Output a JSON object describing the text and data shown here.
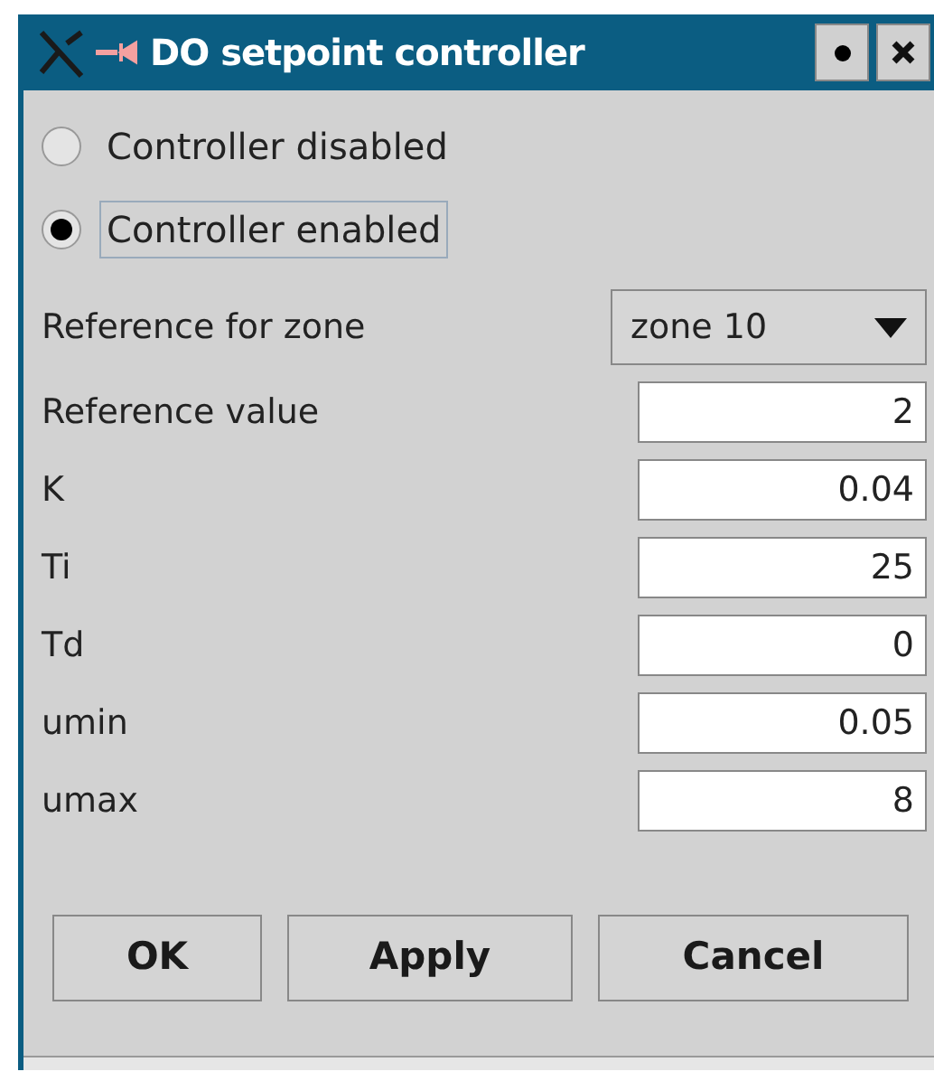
{
  "window": {
    "title": "DO setpoint controller"
  },
  "mode_options": [
    {
      "label": "Controller disabled",
      "selected": false
    },
    {
      "label": "Controller enabled",
      "selected": true
    }
  ],
  "zone": {
    "label": "Reference for zone",
    "value": "zone 10"
  },
  "parameters": [
    {
      "label": "Reference value",
      "value": "2"
    },
    {
      "label": "K",
      "value": "0.04"
    },
    {
      "label": "Ti",
      "value": "25"
    },
    {
      "label": "Td",
      "value": "0"
    },
    {
      "label": "umin",
      "value": "0.05"
    },
    {
      "label": "umax",
      "value": "8"
    }
  ],
  "buttons": [
    "OK",
    "Apply",
    "Cancel"
  ]
}
